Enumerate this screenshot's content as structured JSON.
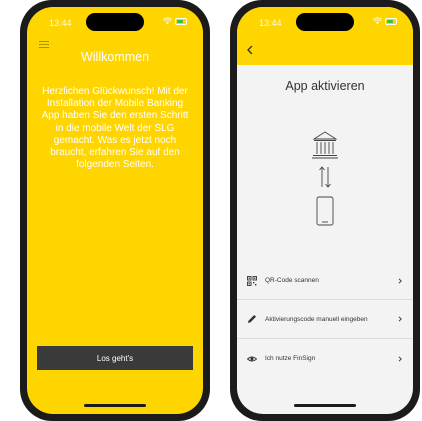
{
  "colors": {
    "brand_yellow": "#ffd500",
    "button_dark": "#3a3a3a",
    "screen_light": "#f3f3f3",
    "battery_green": "#36c23c"
  },
  "left_screen": {
    "status_time": "13:44",
    "title": "Willkommen",
    "body_text": "Herzlichen Glückwunsch! Mit der Installation der Mobile Banking App haben Sie den ersten Schritt in die mobile Welt der SLG gemacht. Was es jetzt noch braucht, erfahren Sie auf den folgenden Seiten.",
    "button_label": "Los geht's",
    "icons": {
      "menu": "menu-icon",
      "wifi": "wifi-icon",
      "battery": "battery-icon"
    }
  },
  "right_screen": {
    "status_time": "13:44",
    "title": "App aktivieren",
    "icons": {
      "back": "back-icon",
      "bank": "bank-icon",
      "transfer": "transfer-arrows-icon",
      "phone": "smartphone-icon"
    },
    "options": [
      {
        "label": "QR-Code scannen",
        "icon": "qr-code-icon"
      },
      {
        "label": "Aktivierungscode manuell eingeben",
        "icon": "pencil-icon"
      },
      {
        "label": "Ich nutze FinSign",
        "icon": "finsign-icon"
      }
    ]
  }
}
